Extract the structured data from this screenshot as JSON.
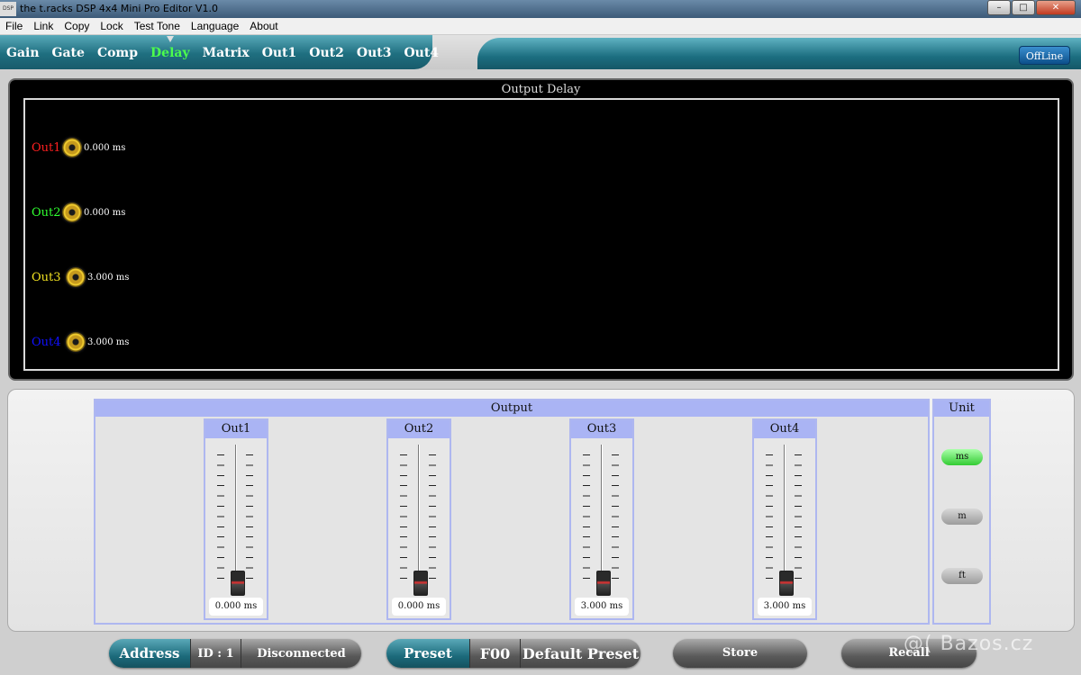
{
  "window": {
    "title": "the t.racks DSP 4x4 Mini Pro Editor V1.0",
    "icon_label": "DSP"
  },
  "menu": [
    "File",
    "Link",
    "Copy",
    "Lock",
    "Test Tone",
    "Language",
    "About"
  ],
  "tabs": [
    {
      "label": "Gain",
      "active": false
    },
    {
      "label": "Gate",
      "active": false
    },
    {
      "label": "Comp",
      "active": false
    },
    {
      "label": "Delay",
      "active": true
    },
    {
      "label": "Matrix",
      "active": false
    },
    {
      "label": "Out1",
      "active": false
    },
    {
      "label": "Out2",
      "active": false
    },
    {
      "label": "Out3",
      "active": false
    },
    {
      "label": "Out4",
      "active": false
    }
  ],
  "status_button": "OffLine",
  "output_delay": {
    "title": "Output Delay",
    "channels": [
      {
        "label": "Out1",
        "value": "0.000 ms",
        "color": "#ff2020"
      },
      {
        "label": "Out2",
        "value": "0.000 ms",
        "color": "#30ff30"
      },
      {
        "label": "Out3",
        "value": "3.000 ms",
        "color": "#f0e020"
      },
      {
        "label": "Out4",
        "value": "3.000 ms",
        "color": "#1010ff"
      }
    ]
  },
  "output_section": {
    "title": "Output",
    "faders": [
      {
        "label": "Out1",
        "value": "0.000 ms",
        "level": 0.0
      },
      {
        "label": "Out2",
        "value": "0.000 ms",
        "level": 0.0
      },
      {
        "label": "Out3",
        "value": "3.000 ms",
        "level": 0.0
      },
      {
        "label": "Out4",
        "value": "3.000 ms",
        "level": 0.0
      }
    ]
  },
  "unit": {
    "title": "Unit",
    "options": [
      {
        "label": "ms",
        "active": true
      },
      {
        "label": "m",
        "active": false
      },
      {
        "label": "ft",
        "active": false
      }
    ]
  },
  "footer": {
    "address_label": "Address",
    "id_label": "ID : 1",
    "connection_status": "Disconnected",
    "preset_label": "Preset",
    "preset_code": "F00",
    "preset_name": "Default Preset",
    "store_label": "Store",
    "recall_label": "Recall"
  },
  "watermark": "@( Bazos.cz"
}
